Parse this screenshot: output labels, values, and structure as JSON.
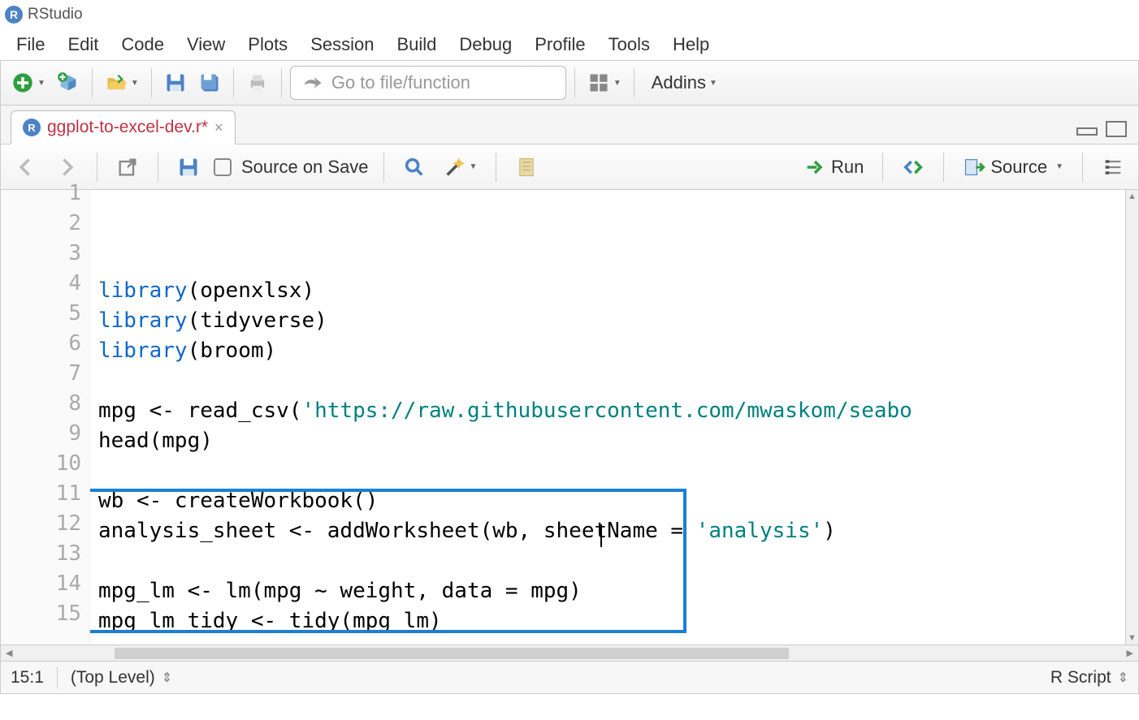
{
  "app": {
    "title": "RStudio"
  },
  "menu": [
    "File",
    "Edit",
    "Code",
    "View",
    "Plots",
    "Session",
    "Build",
    "Debug",
    "Profile",
    "Tools",
    "Help"
  ],
  "toolbar": {
    "goto_placeholder": "Go to file/function",
    "addins_label": "Addins"
  },
  "tab": {
    "filename": "ggplot-to-excel-dev.r*"
  },
  "editor_tb": {
    "source_on_save": "Source on Save",
    "run": "Run",
    "source": "Source"
  },
  "code": {
    "lines": [
      {
        "n": 1,
        "tokens": [
          [
            "c-blue",
            "library"
          ],
          [
            "",
            "(openxlsx)"
          ]
        ],
        "cut": true
      },
      {
        "n": 2,
        "tokens": [
          [
            "c-blue",
            "library"
          ],
          [
            "",
            "(tidyverse)"
          ]
        ]
      },
      {
        "n": 3,
        "tokens": [
          [
            "c-blue",
            "library"
          ],
          [
            "",
            "(broom)"
          ]
        ]
      },
      {
        "n": 4,
        "tokens": []
      },
      {
        "n": 5,
        "tokens": [
          [
            "",
            "mpg <- read_csv("
          ],
          [
            "c-str",
            "'https://raw.githubusercontent.com/mwaskom/seabo"
          ]
        ]
      },
      {
        "n": 6,
        "tokens": [
          [
            "",
            "head(mpg)"
          ]
        ]
      },
      {
        "n": 7,
        "tokens": []
      },
      {
        "n": 8,
        "tokens": [
          [
            "",
            "wb <- createWorkbook()"
          ]
        ]
      },
      {
        "n": 9,
        "tokens": [
          [
            "",
            "analysis_sheet <- addWorksheet(wb, sheetName = "
          ],
          [
            "c-str",
            "'analysis'"
          ],
          [
            "",
            ")"
          ]
        ]
      },
      {
        "n": 10,
        "tokens": []
      },
      {
        "n": 11,
        "tokens": [
          [
            "",
            "mpg_lm <- lm(mpg ~ weight, data = mpg)"
          ]
        ]
      },
      {
        "n": 12,
        "tokens": [
          [
            "",
            "mpg_lm_tidy <- tidy(mpg_lm)"
          ]
        ]
      },
      {
        "n": 13,
        "tokens": []
      },
      {
        "n": 14,
        "tokens": [
          [
            "",
            "mpg_lm_tidy"
          ]
        ]
      },
      {
        "n": 15,
        "tokens": []
      }
    ]
  },
  "status": {
    "cursor": "15:1",
    "scope": "(Top Level)",
    "lang": "R Script"
  }
}
